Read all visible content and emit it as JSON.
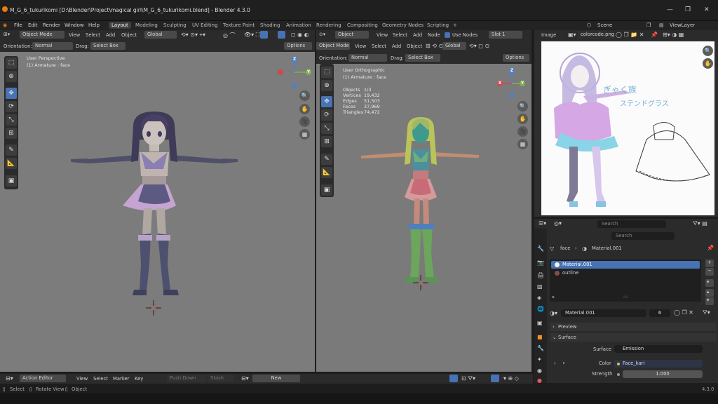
{
  "window": {
    "title": "M_G_6_tukurikomi [D:\\Blender\\Project\\magical girl\\M_G_6_tukurikomi.blend] - Blender 4.3.0",
    "minimize": "—",
    "maximize": "❐",
    "close": "✕"
  },
  "menu": [
    "File",
    "Edit",
    "Render",
    "Window",
    "Help"
  ],
  "workspaces": [
    "Layout",
    "Modeling",
    "Sculpting",
    "UV Editing",
    "Texture Paint",
    "Shading",
    "Animation",
    "Rendering",
    "Compositing",
    "Geometry Nodes",
    "Scripting",
    "+"
  ],
  "scene": {
    "name": "Scene",
    "view_layer": "ViewLayer"
  },
  "left_viewport": {
    "mode": "Object Mode",
    "menus": [
      "View",
      "Select",
      "Add",
      "Object"
    ],
    "orientation_label": "Orientation:",
    "orientation": "Normal",
    "drag_label": "Drag:",
    "drag": "Select Box",
    "transform": "Global",
    "options": "Options",
    "overlay_line1": "User Perspective",
    "overlay_line2": "(1) Armature : face"
  },
  "right_viewport": {
    "mode": "Object",
    "menus": [
      "View",
      "Select",
      "Add",
      "Node"
    ],
    "use_nodes": "Use Nodes",
    "slot": "Slot 1",
    "mode2": "Object Mode",
    "menus2": [
      "View",
      "Select",
      "Add",
      "Object"
    ],
    "transform": "Global",
    "orientation_label": "Orientation:",
    "orientation": "Normal",
    "drag_label": "Drag:",
    "drag": "Select Box",
    "options": "Options",
    "overlay_line1": "User Orthographic",
    "overlay_line2": "(1) Armature : face",
    "stats": [
      {
        "k": "Objects",
        "v": "1/3"
      },
      {
        "k": "Vertices",
        "v": "19,432"
      },
      {
        "k": "Edges",
        "v": "51,503"
      },
      {
        "k": "Faces",
        "v": "37,969"
      },
      {
        "k": "Triangles",
        "v": "74,472"
      }
    ]
  },
  "image_editor": {
    "menu": "Image",
    "image_name": "colorcode.png",
    "sketch_text_line1": "ぎゃく族",
    "sketch_text_line2": "ステンドグラス"
  },
  "outliner": {
    "search_placeholder": "Search"
  },
  "properties": {
    "search_placeholder": "Search",
    "breadcrumb_object": "face",
    "breadcrumb_material": "Material.001",
    "slots": [
      "Material.001",
      "outline"
    ],
    "material_name": "Material.001",
    "user_count": "6",
    "preview_label": "Preview",
    "surface_label": "Surface",
    "surface_field_label": "Surface",
    "surface_value": "Emission",
    "color_label": "Color",
    "color_value": "Face_kari",
    "strength_label": "Strength",
    "strength_value": "1.000"
  },
  "timeline": {
    "editor": "Action Editor",
    "menus": [
      "View",
      "Select",
      "Marker",
      "Key"
    ],
    "push_down": "Push Down",
    "stash": "Stash",
    "new": "New"
  },
  "statusbar": {
    "select": "Select",
    "rotate": "Rotate View",
    "object": "Object",
    "version": "4.3.0"
  },
  "colors": {
    "accent": "#4772b3",
    "viewport_bg": "#7c7c7c",
    "x_axis": "#d0464f",
    "y_axis": "#7fb24e",
    "z_axis": "#4a7fd4"
  }
}
